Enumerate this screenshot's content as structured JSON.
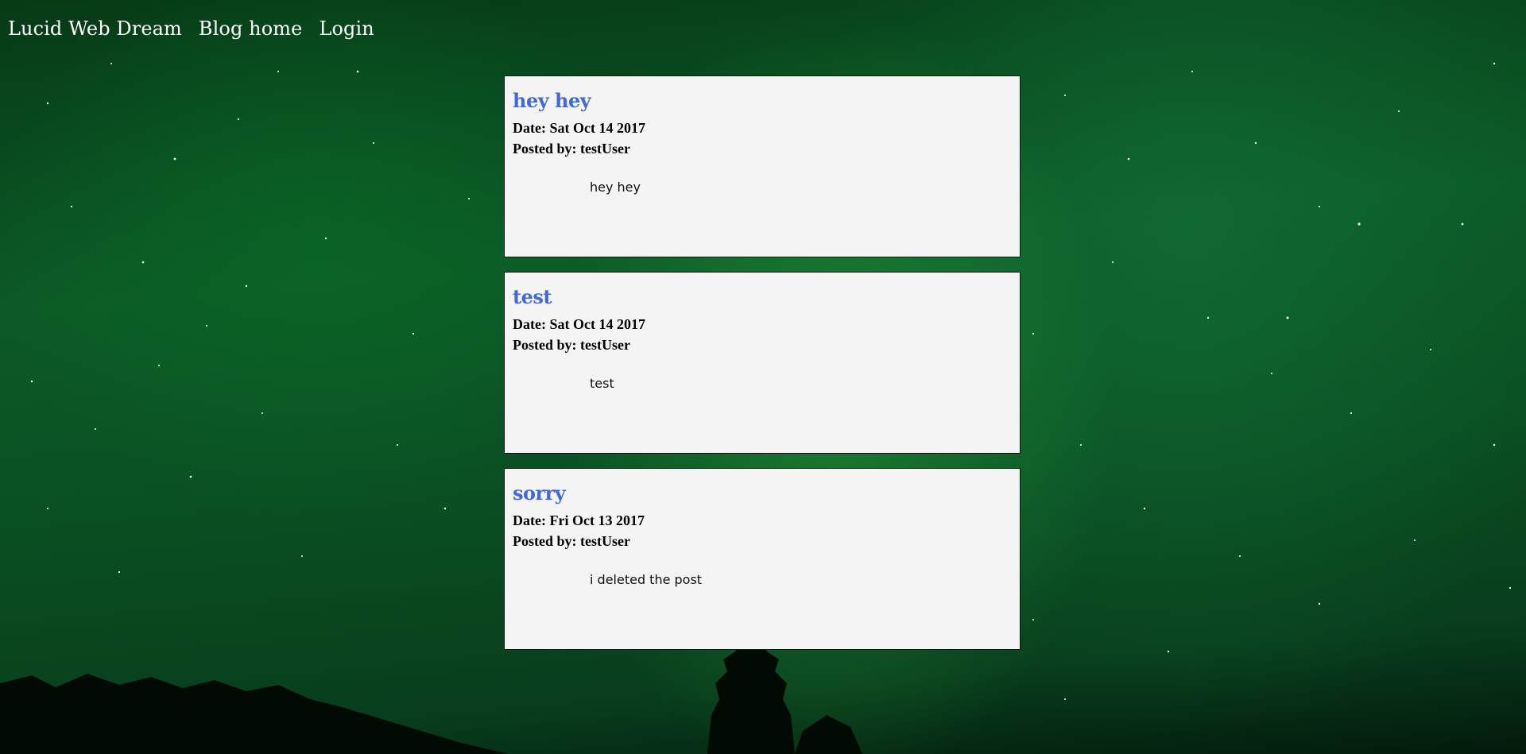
{
  "nav": {
    "brand": "Lucid Web Dream",
    "blog_home": "Blog home",
    "login": "Login"
  },
  "colors": {
    "title_link": "#4169d9",
    "card_background": "#f4f4f4",
    "page_background": "#0a4f22"
  },
  "posts": [
    {
      "title": "hey hey",
      "date_line": "Date: Sat Oct 14 2017",
      "posted_by_line": "Posted by: testUser",
      "body": "hey hey"
    },
    {
      "title": "test",
      "date_line": "Date: Sat Oct 14 2017",
      "posted_by_line": "Posted by: testUser",
      "body": "test"
    },
    {
      "title": "sorry",
      "date_line": "Date: Fri Oct 13 2017",
      "posted_by_line": "Posted by: testUser",
      "body": "i deleted the post"
    }
  ]
}
